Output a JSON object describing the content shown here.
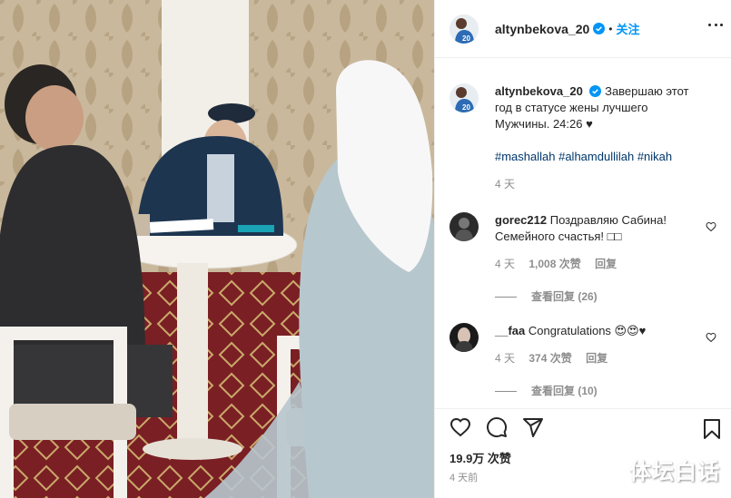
{
  "post": {
    "author": {
      "username": "altynbekova_20",
      "verified": true
    },
    "follow_label": "关注",
    "separator": "•",
    "caption": {
      "text": "Завершаю этот год в статусе жены лучшего Мужчины. 24:26 ♥",
      "hashtags": "#mashallah #alhamdullilah #nikah",
      "time": "4 天"
    },
    "comments": [
      {
        "username": "gorec212",
        "text": "Поздравляю Сабина! Семейного счастья! □□",
        "time": "4 天",
        "likes": "1,008 次赞",
        "reply_label": "回复",
        "view_replies": "查看回复 (26)"
      },
      {
        "username": "__faa",
        "text": "Congratulations 😍😍♥",
        "time": "4 天",
        "likes": "374 次赞",
        "reply_label": "回复",
        "view_replies": "查看回复 (10)"
      }
    ],
    "like_count": "19.9万 次赞",
    "posted_ago": "4 天前"
  },
  "watermark": "体坛白话",
  "icons": {
    "like": "heart-icon",
    "comment": "comment-icon",
    "share": "share-icon",
    "save": "bookmark-icon",
    "more": "more-options-icon",
    "verified": "verified-badge-icon",
    "comment_like": "heart-small-icon"
  },
  "colors": {
    "accent": "#0095f6",
    "text": "#262626",
    "secondary": "#8e8e8e",
    "hashtag": "#00376b",
    "border": "#efefef"
  }
}
